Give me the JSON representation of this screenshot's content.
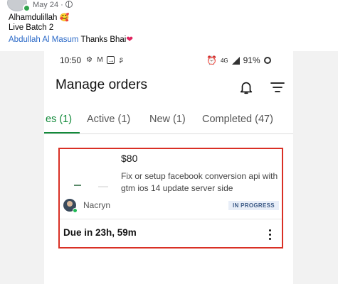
{
  "post": {
    "date": "May 24 ·",
    "line1": "Alhamdulillah",
    "line1_emoji": "🥰",
    "line2": "Live Batch 2",
    "mention": "Abdullah Al Masum",
    "thanks": " Thanks Bhai",
    "heart": "❤"
  },
  "status_bar": {
    "time": "10:50",
    "battery": "91%",
    "network": "4G"
  },
  "header": {
    "title": "Manage orders"
  },
  "tabs": [
    {
      "label": "es (1)",
      "active": true
    },
    {
      "label": "Active (1)",
      "active": false
    },
    {
      "label": "New (1)",
      "active": false
    },
    {
      "label": "Completed (47)",
      "active": false
    }
  ],
  "order": {
    "price": "$80",
    "description": "Fix or setup facebook conversion api with gtm ios 14 update server side",
    "seller": "Nacryn",
    "status": "IN PROGRESS",
    "due": "Due in 23h, 59m"
  },
  "colors": {
    "accent": "#128a3a",
    "highlight_border": "#d93025",
    "link": "#2d6bc8",
    "badge_text": "#3d5b86"
  }
}
